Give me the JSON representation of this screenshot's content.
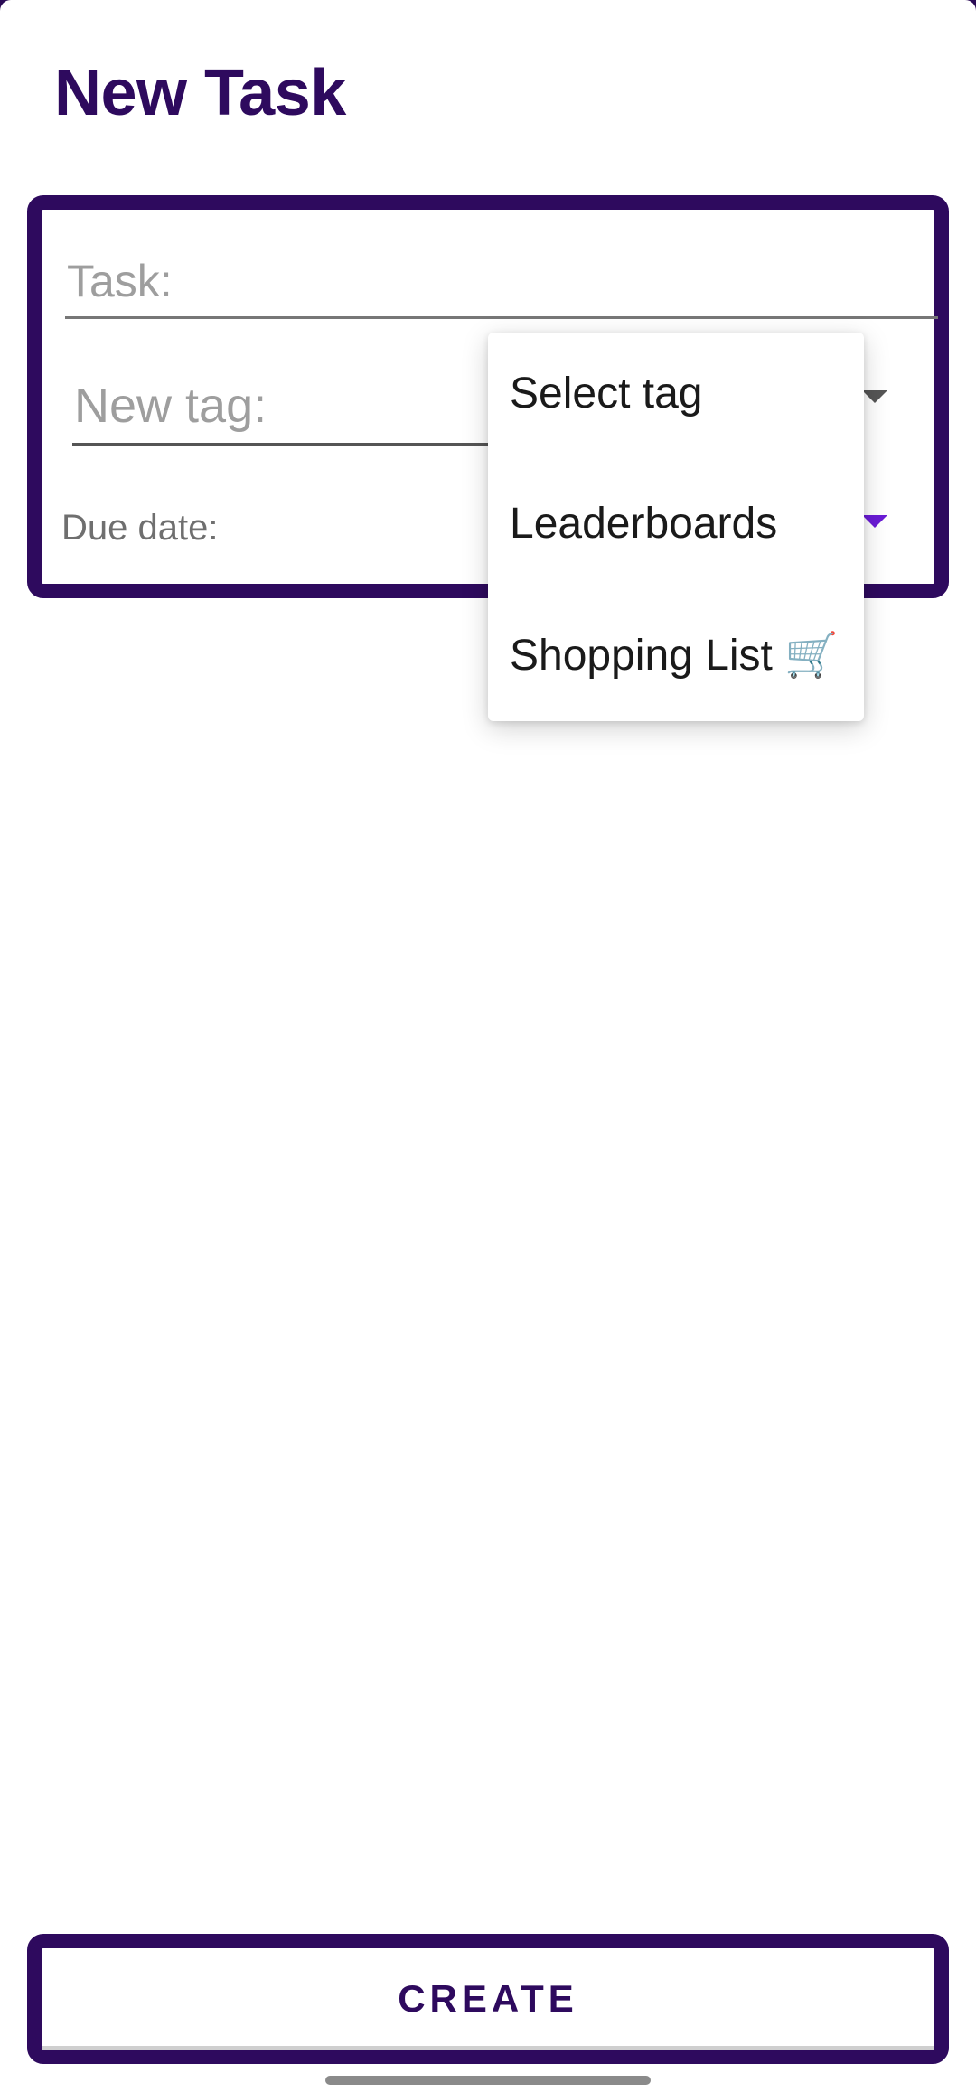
{
  "screen": {
    "title": "New Task"
  },
  "form": {
    "task_placeholder": "Task:",
    "new_tag_placeholder": "New tag:",
    "due_date_label": "Due date:"
  },
  "tag_dropdown": {
    "options": [
      "Select tag",
      "Leaderboards",
      "Shopping List 🛒"
    ]
  },
  "actions": {
    "create_label": "CREATE"
  },
  "icons": {
    "tag_dropdown_arrow": "caret-down-icon",
    "date_dropdown_arrow": "caret-down-icon"
  },
  "colors": {
    "primary": "#2e0a5e",
    "accent": "#6a1bd6",
    "placeholder": "#9e9e9e"
  }
}
